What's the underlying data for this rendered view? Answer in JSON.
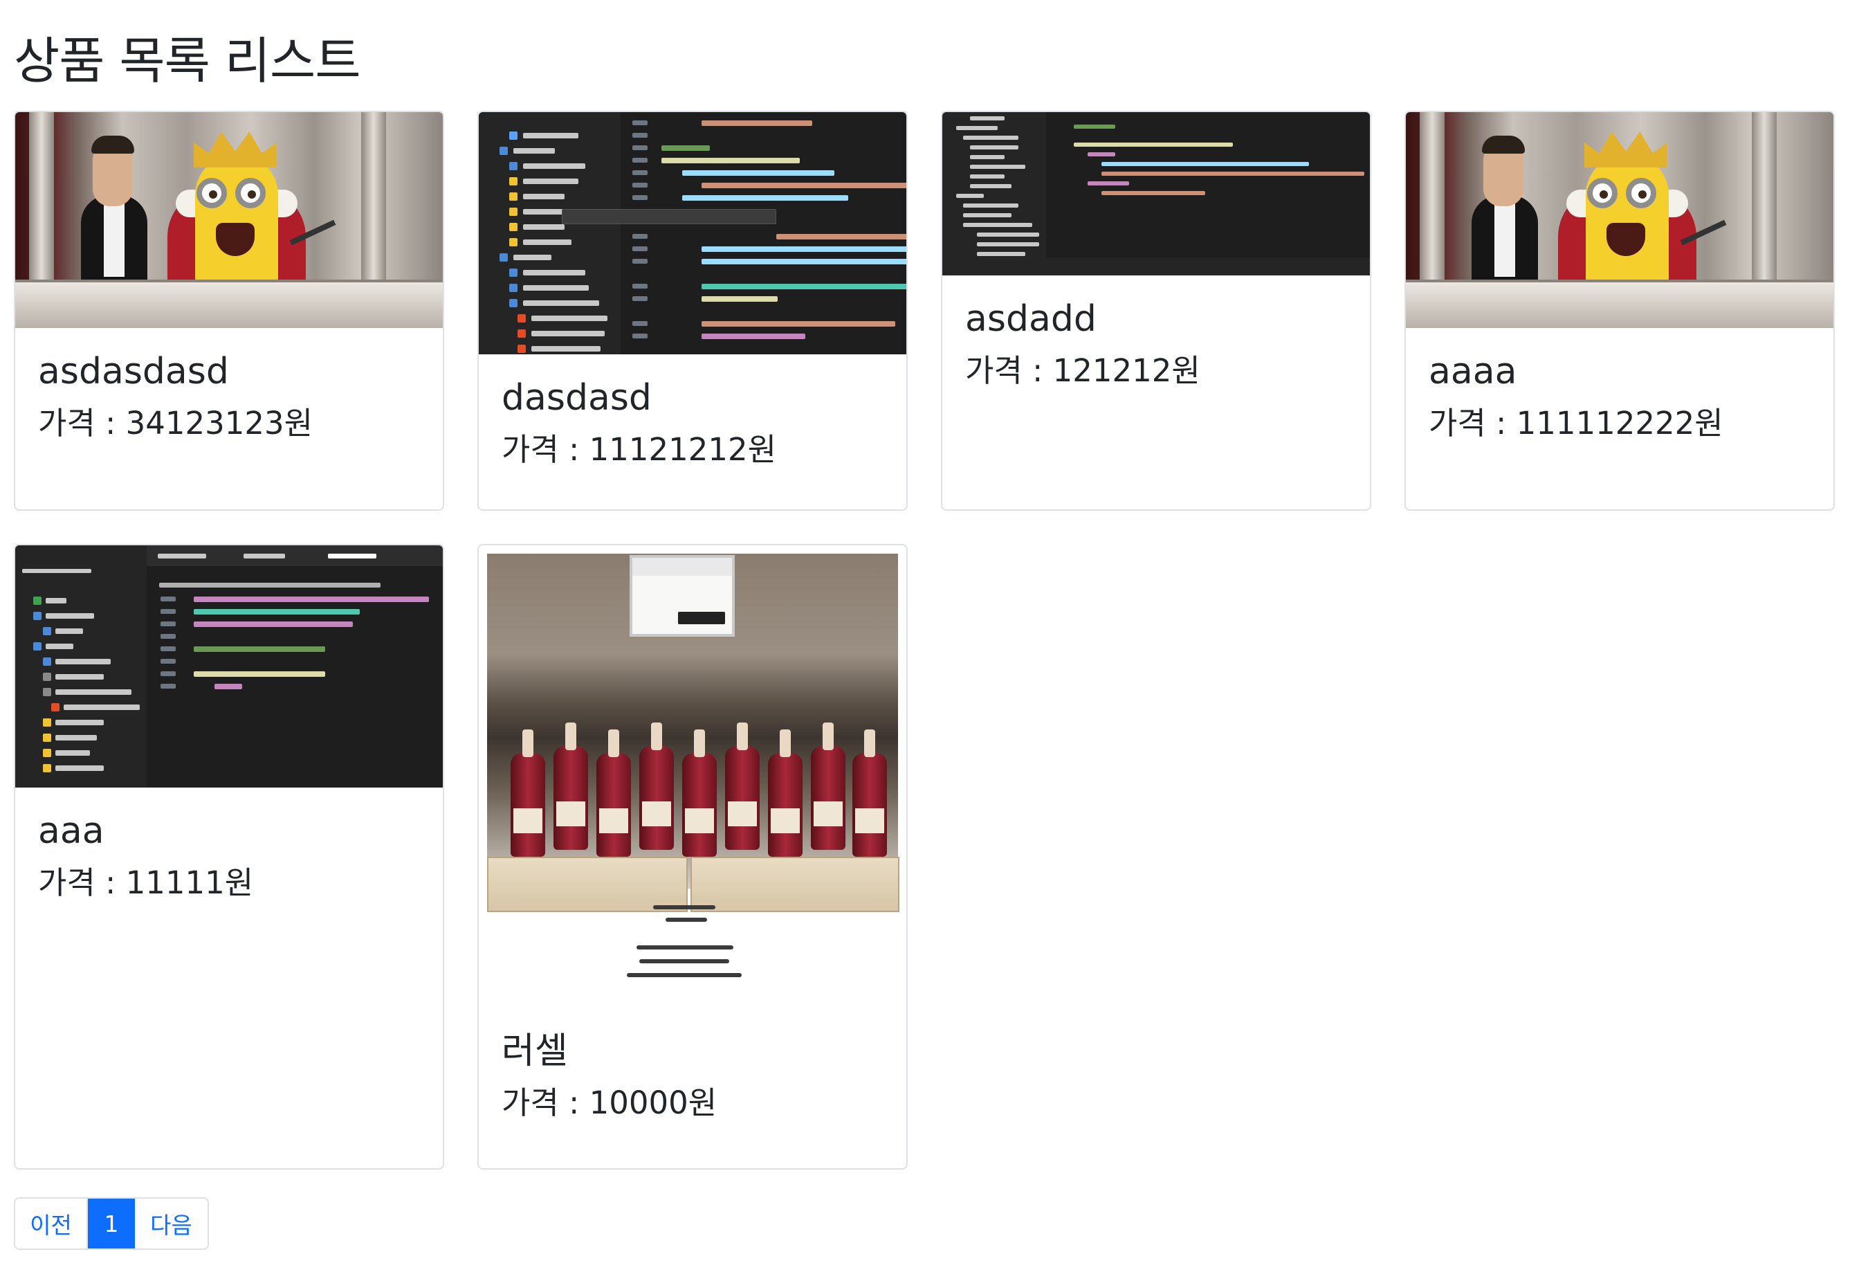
{
  "page": {
    "title": "상품 목록 리스트"
  },
  "products": [
    {
      "name": "asdasdasd",
      "price_label": "가격 : 34123123원",
      "image": "minion-king-photo"
    },
    {
      "name": "dasdasd",
      "price_label": "가격 : 11121212원",
      "image": "vscode-django-create-view-screenshot"
    },
    {
      "name": "asdadd",
      "price_label": "가격 : 121212원",
      "image": "vscode-django-info-view-screenshot"
    },
    {
      "name": "aaaa",
      "price_label": "가격 : 111112222원",
      "image": "minion-king-photo"
    },
    {
      "name": "aaa",
      "price_label": "가격 : 11111원",
      "image": "vscode-django-list-view-screenshot"
    },
    {
      "name": "러셀",
      "price_label": "가격 : 10000원",
      "image": "russells-bourbon-shelf-photo"
    }
  ],
  "pagination": {
    "prev": "이전",
    "current": "1",
    "next": "다음"
  },
  "colors": {
    "accent": "#0d6efd",
    "border": "#dee2e6",
    "text": "#212529"
  }
}
